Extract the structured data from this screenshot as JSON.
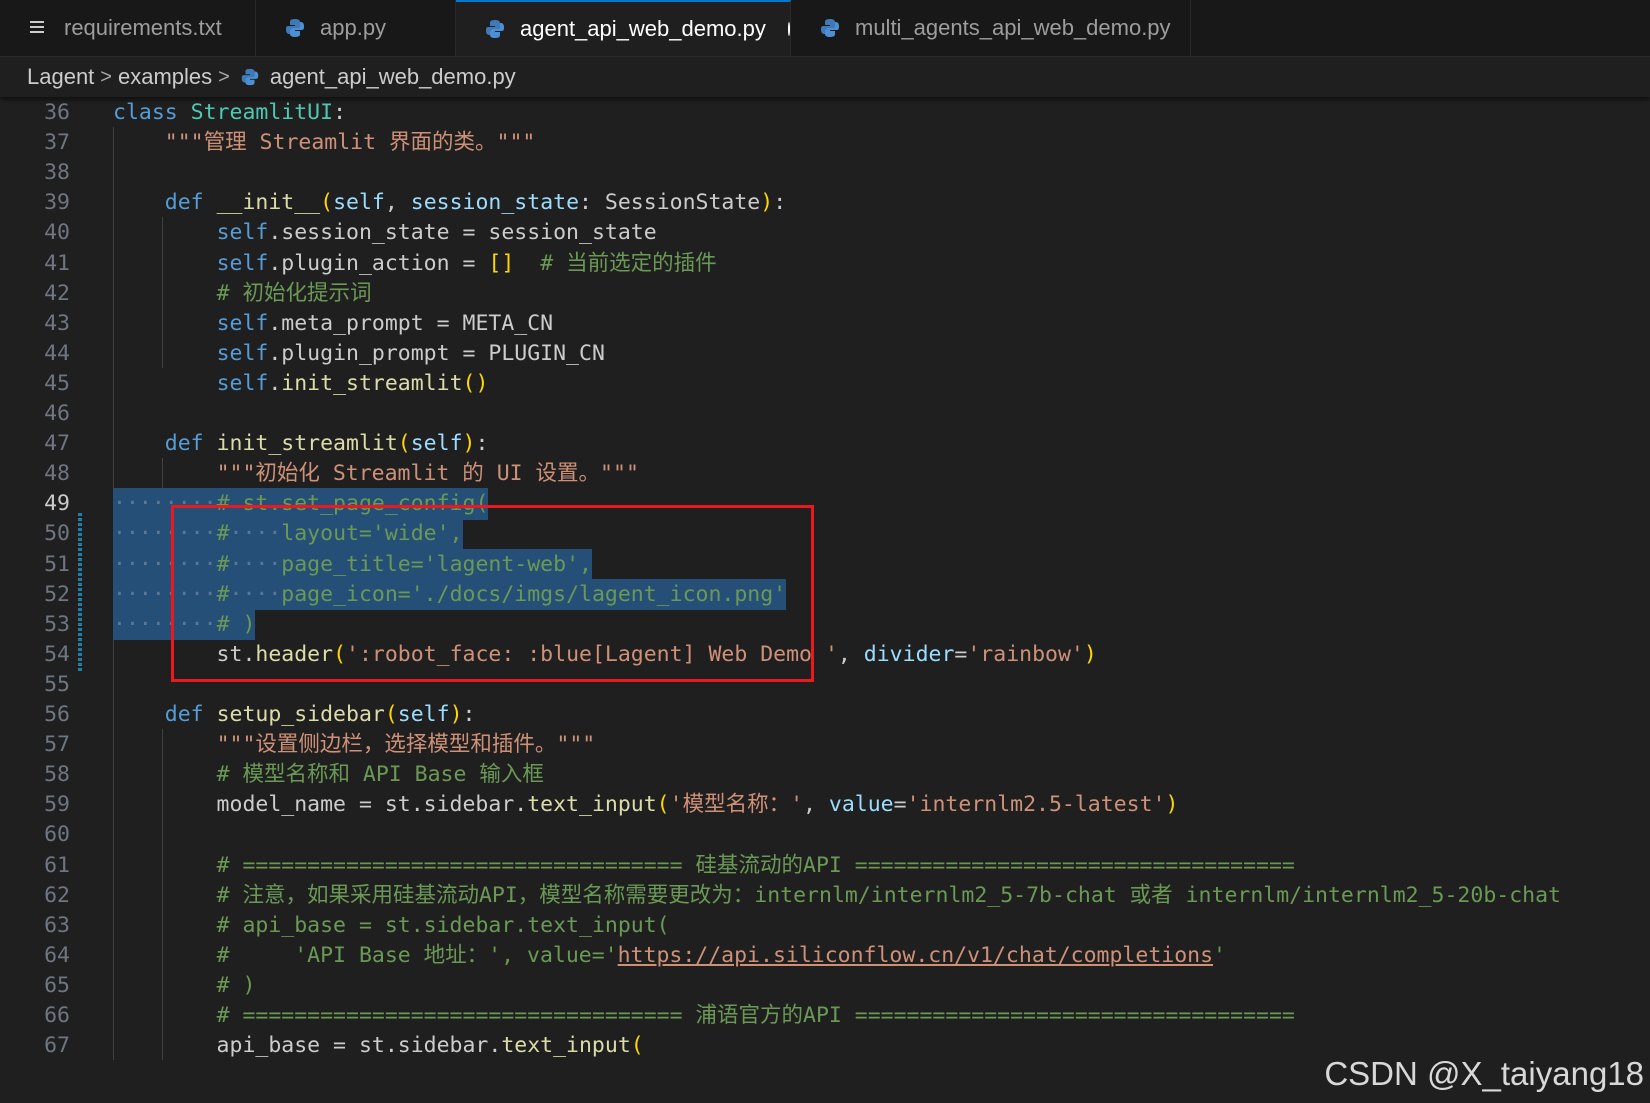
{
  "tabs": [
    {
      "label": "requirements.txt",
      "icon": "list-lines-icon",
      "active": false
    },
    {
      "label": "app.py",
      "icon": "python-icon",
      "active": false
    },
    {
      "label": "agent_api_web_demo.py",
      "icon": "python-icon",
      "active": true,
      "modified": true
    },
    {
      "label": "multi_agents_api_web_demo.py",
      "icon": "python-icon",
      "active": false
    }
  ],
  "breadcrumb": {
    "items": [
      "Lagent",
      "examples",
      "agent_api_web_demo.py"
    ],
    "separator": ">"
  },
  "editor": {
    "current_line": 49,
    "selection_lines": [
      49,
      50,
      51,
      52,
      53
    ],
    "lines": [
      {
        "n": 36,
        "tokens": [
          [
            "kw",
            "class "
          ],
          [
            "cls",
            "StreamlitUI"
          ],
          [
            "plain",
            ":"
          ]
        ]
      },
      {
        "n": 37,
        "tokens": [
          [
            "plain",
            "    "
          ],
          [
            "str",
            "\"\"\"管理 Streamlit 界面的类。\"\"\""
          ]
        ]
      },
      {
        "n": 38,
        "tokens": []
      },
      {
        "n": 39,
        "tokens": [
          [
            "plain",
            "    "
          ],
          [
            "kw",
            "def "
          ],
          [
            "fn",
            "__init__"
          ],
          [
            "br1",
            "("
          ],
          [
            "param",
            "self"
          ],
          [
            "plain",
            ", "
          ],
          [
            "param",
            "session_state"
          ],
          [
            "plain",
            ": "
          ],
          [
            "plain",
            "SessionState"
          ],
          [
            "br1",
            ")"
          ],
          [
            "plain",
            ":"
          ]
        ]
      },
      {
        "n": 40,
        "tokens": [
          [
            "plain",
            "        "
          ],
          [
            "kw",
            "self"
          ],
          [
            "plain",
            ".session_state = session_state"
          ]
        ]
      },
      {
        "n": 41,
        "tokens": [
          [
            "plain",
            "        "
          ],
          [
            "kw",
            "self"
          ],
          [
            "plain",
            ".plugin_action = "
          ],
          [
            "br1",
            "[]"
          ],
          [
            "plain",
            "  "
          ],
          [
            "cmt",
            "# 当前选定的插件"
          ]
        ]
      },
      {
        "n": 42,
        "tokens": [
          [
            "plain",
            "        "
          ],
          [
            "cmt",
            "# 初始化提示词"
          ]
        ]
      },
      {
        "n": 43,
        "tokens": [
          [
            "plain",
            "        "
          ],
          [
            "kw",
            "self"
          ],
          [
            "plain",
            ".meta_prompt = META_CN"
          ]
        ]
      },
      {
        "n": 44,
        "tokens": [
          [
            "plain",
            "        "
          ],
          [
            "kw",
            "self"
          ],
          [
            "plain",
            ".plugin_prompt = PLUGIN_CN"
          ]
        ]
      },
      {
        "n": 45,
        "tokens": [
          [
            "plain",
            "        "
          ],
          [
            "kw",
            "self"
          ],
          [
            "plain",
            "."
          ],
          [
            "fn",
            "init_streamlit"
          ],
          [
            "br1",
            "()"
          ]
        ]
      },
      {
        "n": 46,
        "tokens": []
      },
      {
        "n": 47,
        "tokens": [
          [
            "plain",
            "    "
          ],
          [
            "kw",
            "def "
          ],
          [
            "fn",
            "init_streamlit"
          ],
          [
            "br1",
            "("
          ],
          [
            "param",
            "self"
          ],
          [
            "br1",
            ")"
          ],
          [
            "plain",
            ":"
          ]
        ]
      },
      {
        "n": 48,
        "tokens": [
          [
            "plain",
            "        "
          ],
          [
            "str",
            "\"\"\"初始化 Streamlit 的 UI 设置。\"\"\""
          ]
        ]
      },
      {
        "n": 49,
        "tokens": [
          [
            "ws",
            "····"
          ],
          [
            "ws",
            "····"
          ],
          [
            "cmt",
            "# st.set_page_config("
          ]
        ]
      },
      {
        "n": 50,
        "tokens": [
          [
            "ws",
            "····"
          ],
          [
            "ws",
            "····"
          ],
          [
            "cmt",
            "#"
          ],
          [
            "ws",
            "····"
          ],
          [
            "cmt",
            "layout='wide',"
          ]
        ]
      },
      {
        "n": 51,
        "tokens": [
          [
            "ws",
            "····"
          ],
          [
            "ws",
            "····"
          ],
          [
            "cmt",
            "#"
          ],
          [
            "ws",
            "····"
          ],
          [
            "cmt",
            "page_title='lagent-web',"
          ]
        ]
      },
      {
        "n": 52,
        "tokens": [
          [
            "ws",
            "····"
          ],
          [
            "ws",
            "····"
          ],
          [
            "cmt",
            "#"
          ],
          [
            "ws",
            "····"
          ],
          [
            "cmt",
            "page_icon='./docs/imgs/lagent_icon.png'"
          ]
        ]
      },
      {
        "n": 53,
        "tokens": [
          [
            "ws",
            "····"
          ],
          [
            "ws",
            "····"
          ],
          [
            "cmt",
            "# )"
          ]
        ]
      },
      {
        "n": 54,
        "tokens": [
          [
            "plain",
            "        st."
          ],
          [
            "fn",
            "header"
          ],
          [
            "br1",
            "("
          ],
          [
            "str",
            "':robot_face: :blue[Lagent] Web Demo '"
          ],
          [
            "plain",
            ", "
          ],
          [
            "param",
            "divider"
          ],
          [
            "plain",
            "="
          ],
          [
            "str",
            "'rainbow'"
          ],
          [
            "br1",
            ")"
          ]
        ]
      },
      {
        "n": 55,
        "tokens": []
      },
      {
        "n": 56,
        "tokens": [
          [
            "plain",
            "    "
          ],
          [
            "kw",
            "def "
          ],
          [
            "fn",
            "setup_sidebar"
          ],
          [
            "br1",
            "("
          ],
          [
            "param",
            "self"
          ],
          [
            "br1",
            ")"
          ],
          [
            "plain",
            ":"
          ]
        ]
      },
      {
        "n": 57,
        "tokens": [
          [
            "plain",
            "        "
          ],
          [
            "str",
            "\"\"\"设置侧边栏，选择模型和插件。\"\"\""
          ]
        ]
      },
      {
        "n": 58,
        "tokens": [
          [
            "plain",
            "        "
          ],
          [
            "cmt",
            "# 模型名称和 API Base 输入框"
          ]
        ]
      },
      {
        "n": 59,
        "tokens": [
          [
            "plain",
            "        model_name = st.sidebar."
          ],
          [
            "fn",
            "text_input"
          ],
          [
            "br1",
            "("
          ],
          [
            "str",
            "'模型名称：'"
          ],
          [
            "plain",
            ", "
          ],
          [
            "param",
            "value"
          ],
          [
            "plain",
            "="
          ],
          [
            "str",
            "'internlm2.5-latest'"
          ],
          [
            "br1",
            ")"
          ]
        ]
      },
      {
        "n": 60,
        "tokens": []
      },
      {
        "n": 61,
        "tokens": [
          [
            "plain",
            "        "
          ],
          [
            "cmt",
            "# ================================== 硅基流动的API =================================="
          ]
        ]
      },
      {
        "n": 62,
        "tokens": [
          [
            "plain",
            "        "
          ],
          [
            "cmt",
            "# 注意，如果采用硅基流动API，模型名称需要更改为：internlm/internlm2_5-7b-chat 或者 internlm/internlm2_5-20b-chat"
          ]
        ]
      },
      {
        "n": 63,
        "tokens": [
          [
            "plain",
            "        "
          ],
          [
            "cmt",
            "# api_base = st.sidebar.text_input("
          ]
        ]
      },
      {
        "n": 64,
        "tokens": [
          [
            "plain",
            "        "
          ],
          [
            "cmt",
            "#     'API Base 地址：', value='"
          ],
          [
            "url",
            "https://api.siliconflow.cn/v1/chat/completions"
          ],
          [
            "cmt",
            "'"
          ]
        ]
      },
      {
        "n": 65,
        "tokens": [
          [
            "plain",
            "        "
          ],
          [
            "cmt",
            "# )"
          ]
        ]
      },
      {
        "n": 66,
        "tokens": [
          [
            "plain",
            "        "
          ],
          [
            "cmt",
            "# ================================== 浦语官方的API =================================="
          ]
        ]
      },
      {
        "n": 67,
        "tokens": [
          [
            "plain",
            "        api_base = st.sidebar."
          ],
          [
            "fn",
            "text_input"
          ],
          [
            "br1",
            "("
          ]
        ]
      }
    ]
  },
  "watermark": "CSDN @X_taiyang18",
  "colors": {
    "accent": "#0078d4",
    "selection": "#264f78",
    "annotation_box": "#e8191f"
  }
}
